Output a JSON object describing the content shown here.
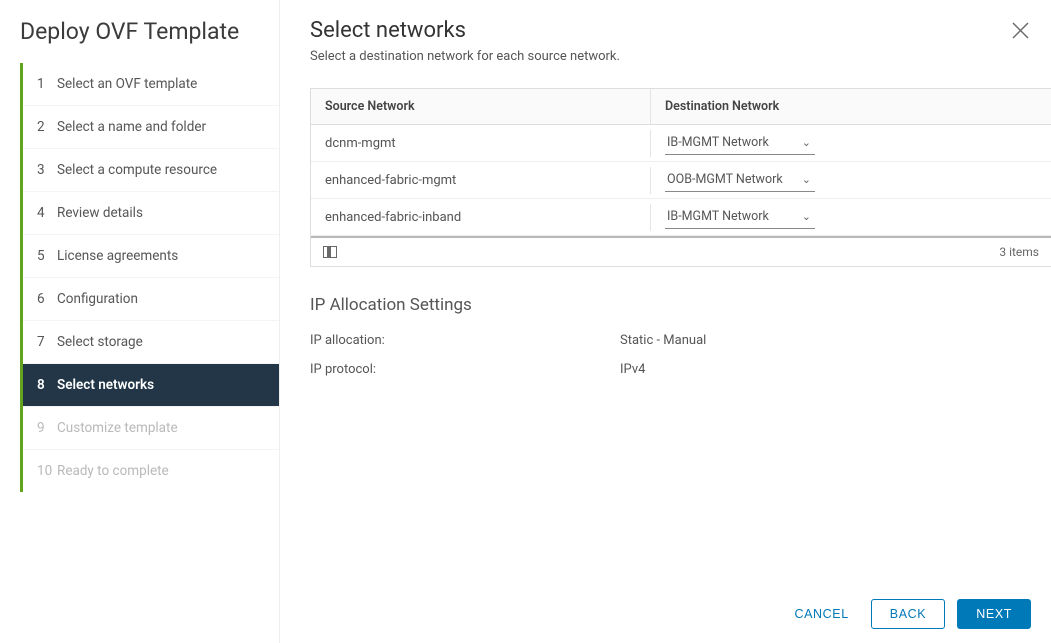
{
  "sidebar": {
    "title": "Deploy OVF Template",
    "steps": [
      {
        "num": "1",
        "label": "Select an OVF template",
        "state": "done"
      },
      {
        "num": "2",
        "label": "Select a name and folder",
        "state": "done"
      },
      {
        "num": "3",
        "label": "Select a compute resource",
        "state": "done"
      },
      {
        "num": "4",
        "label": "Review details",
        "state": "done"
      },
      {
        "num": "5",
        "label": "License agreements",
        "state": "done"
      },
      {
        "num": "6",
        "label": "Configuration",
        "state": "done"
      },
      {
        "num": "7",
        "label": "Select storage",
        "state": "done"
      },
      {
        "num": "8",
        "label": "Select networks",
        "state": "active"
      },
      {
        "num": "9",
        "label": "Customize template",
        "state": "disabled"
      },
      {
        "num": "10",
        "label": "Ready to complete",
        "state": "disabled"
      }
    ]
  },
  "main": {
    "title": "Select networks",
    "subtitle": "Select a destination network for each source network.",
    "table": {
      "headers": {
        "source": "Source Network",
        "destination": "Destination Network"
      },
      "rows": [
        {
          "source": "dcnm-mgmt",
          "destination": "IB-MGMT Network"
        },
        {
          "source": "enhanced-fabric-mgmt",
          "destination": "OOB-MGMT Network"
        },
        {
          "source": "enhanced-fabric-inband",
          "destination": "IB-MGMT Network"
        }
      ],
      "footer_count": "3 items"
    },
    "ip_section": {
      "title": "IP Allocation Settings",
      "rows": [
        {
          "key": "IP allocation:",
          "value": "Static - Manual"
        },
        {
          "key": "IP protocol:",
          "value": "IPv4"
        }
      ]
    }
  },
  "footer": {
    "cancel": "CANCEL",
    "back": "BACK",
    "next": "NEXT"
  }
}
